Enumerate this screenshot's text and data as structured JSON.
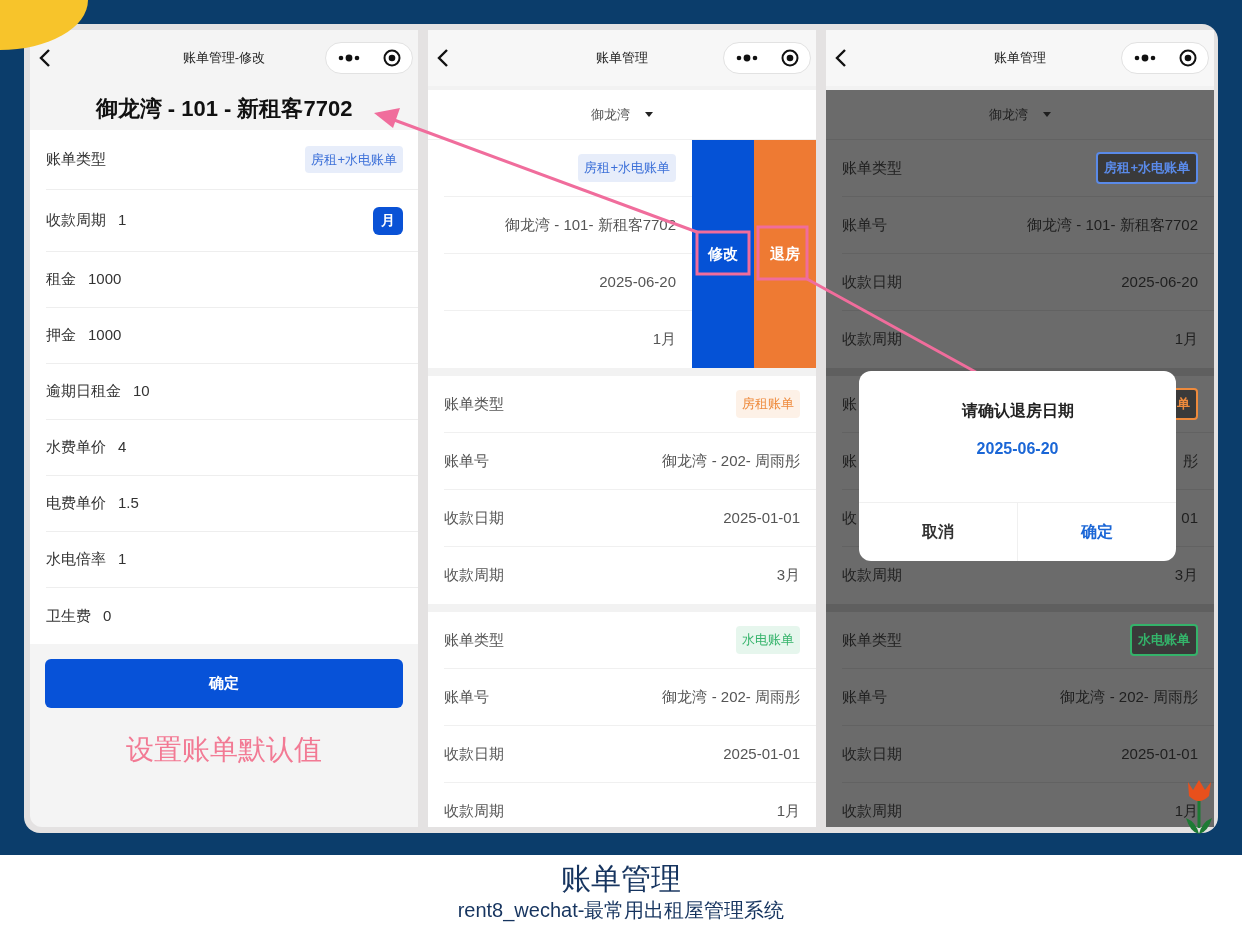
{
  "screens": [
    {
      "kind": "edit",
      "nav_title": "账单管理-修改",
      "heading": "御龙湾 - 101 - 新租客7702",
      "fields": [
        {
          "kind": "tag",
          "label": "账单类型",
          "value": "房租+水电账单",
          "color": "#3b6fd8"
        },
        {
          "kind": "unit",
          "label": "收款周期",
          "value": "1",
          "unit": "月"
        },
        {
          "kind": "text",
          "label": "租金",
          "value": "1000"
        },
        {
          "kind": "text",
          "label": "押金",
          "value": "1000"
        },
        {
          "kind": "text",
          "label": "逾期日租金",
          "value": "10"
        },
        {
          "kind": "text",
          "label": "水费单价",
          "value": "4"
        },
        {
          "kind": "text",
          "label": "电费单价",
          "value": "1.5"
        },
        {
          "kind": "text",
          "label": "水电倍率",
          "value": "1"
        },
        {
          "kind": "text",
          "label": "卫生费",
          "value": "0"
        }
      ],
      "submit": "确定",
      "note": "设置账单默认值"
    },
    {
      "kind": "list",
      "nav_title": "账单管理",
      "filter": "御龙湾",
      "dimmed": false,
      "cards": [
        {
          "rows": [
            {
              "kind": "tag",
              "value": "房租+水电账单",
              "color": "#3b6fd8"
            },
            {
              "kind": "text",
              "value": "御龙湾 - 101- 新租客7702"
            },
            {
              "kind": "text",
              "value": "2025-06-20"
            },
            {
              "kind": "text",
              "value": "1月"
            }
          ],
          "actions": [
            {
              "label": "修改",
              "color": "#0552d6"
            },
            {
              "label": "退房",
              "color": "#ee7a33"
            }
          ]
        },
        {
          "rows": [
            {
              "kind": "tag",
              "label": "账单类型",
              "value": "房租账单",
              "color": "#ee8a3c"
            },
            {
              "kind": "text",
              "label": "账单号",
              "value": "御龙湾 - 202- 周雨彤"
            },
            {
              "kind": "text",
              "label": "收款日期",
              "value": "2025-01-01"
            },
            {
              "kind": "text",
              "label": "收款周期",
              "value": "3月"
            }
          ]
        },
        {
          "rows": [
            {
              "kind": "tag",
              "label": "账单类型",
              "value": "水电账单",
              "color": "#34b36a"
            },
            {
              "kind": "text",
              "label": "账单号",
              "value": "御龙湾 - 202- 周雨彤"
            },
            {
              "kind": "text",
              "label": "收款日期",
              "value": "2025-01-01"
            },
            {
              "kind": "text",
              "label": "收款周期",
              "value": "1月"
            }
          ]
        }
      ]
    },
    {
      "kind": "list",
      "nav_title": "账单管理",
      "filter": "御龙湾",
      "dimmed": true,
      "cards": [
        {
          "rows": [
            {
              "kind": "tag",
              "label": "账单类型",
              "value": "房租+水电账单",
              "color": "#5a8ae8"
            },
            {
              "kind": "text",
              "label": "账单号",
              "value": "御龙湾 - 101- 新租客7702"
            },
            {
              "kind": "text",
              "label": "收款日期",
              "value": "2025-06-20"
            },
            {
              "kind": "text",
              "label": "收款周期",
              "value": "1月"
            }
          ]
        },
        {
          "rows": [
            {
              "kind": "tag",
              "label": "账",
              "value": "单",
              "color": "#ee8a3c"
            },
            {
              "kind": "text",
              "label": "账",
              "value": "彤"
            },
            {
              "kind": "text",
              "label": "收",
              "value": "01"
            },
            {
              "kind": "text",
              "label": "收款周期",
              "value": "3月"
            }
          ]
        },
        {
          "rows": [
            {
              "kind": "tag",
              "label": "账单类型",
              "value": "水电账单",
              "color": "#34b36a"
            },
            {
              "kind": "text",
              "label": "账单号",
              "value": "御龙湾 - 202- 周雨彤"
            },
            {
              "kind": "text",
              "label": "收款日期",
              "value": "2025-01-01"
            },
            {
              "kind": "text",
              "label": "收款周期",
              "value": "1月"
            }
          ]
        }
      ],
      "dialog": {
        "title": "请确认退房日期",
        "date": "2025-06-20",
        "cancel": "取消",
        "confirm": "确定"
      }
    }
  ],
  "caption": {
    "title": "账单管理",
    "subtitle": "rent8_wechat-最常用出租屋管理系统"
  }
}
